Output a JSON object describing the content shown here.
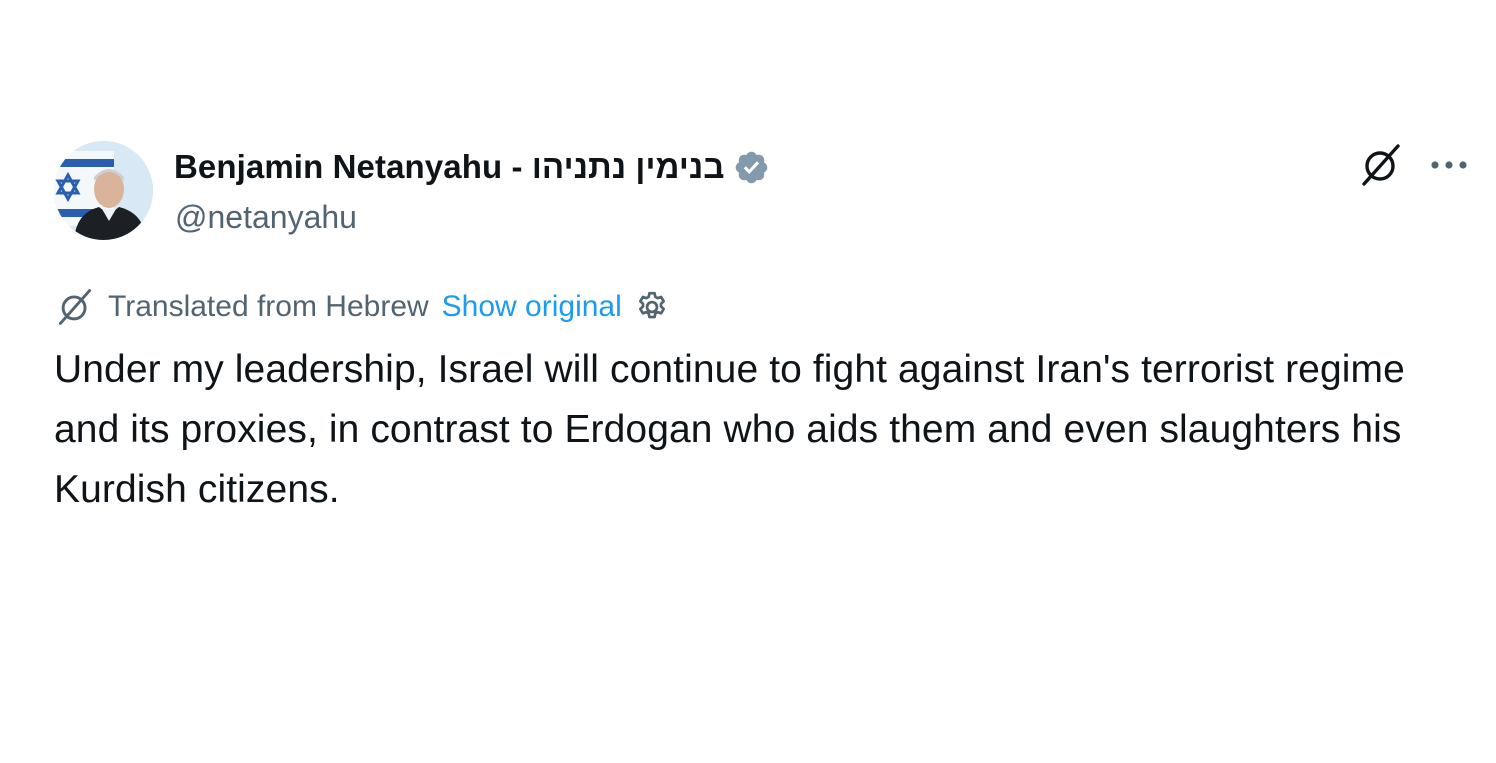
{
  "author": {
    "display_name": "Benjamin Netanyahu - בנימין נתניהו",
    "handle": "@netanyahu",
    "verified": true,
    "verified_color": "#829aab",
    "avatar_icon": "profile-photo"
  },
  "actions": {
    "grok_icon": "grok-icon",
    "more_icon": "more-horizontal-icon"
  },
  "translation": {
    "notice": "Translated from Hebrew",
    "show_original_label": "Show original",
    "link_color": "#1d9bf0",
    "settings_icon": "gear-icon"
  },
  "tweet": {
    "text": "Under my leadership, Israel will continue to fight against Iran's terrorist regime and its proxies, in contrast to Erdogan who aids them and even slaughters his Kurdish citizens."
  },
  "colors": {
    "text_primary": "#0f1419",
    "text_secondary": "#536471",
    "background": "#ffffff"
  }
}
